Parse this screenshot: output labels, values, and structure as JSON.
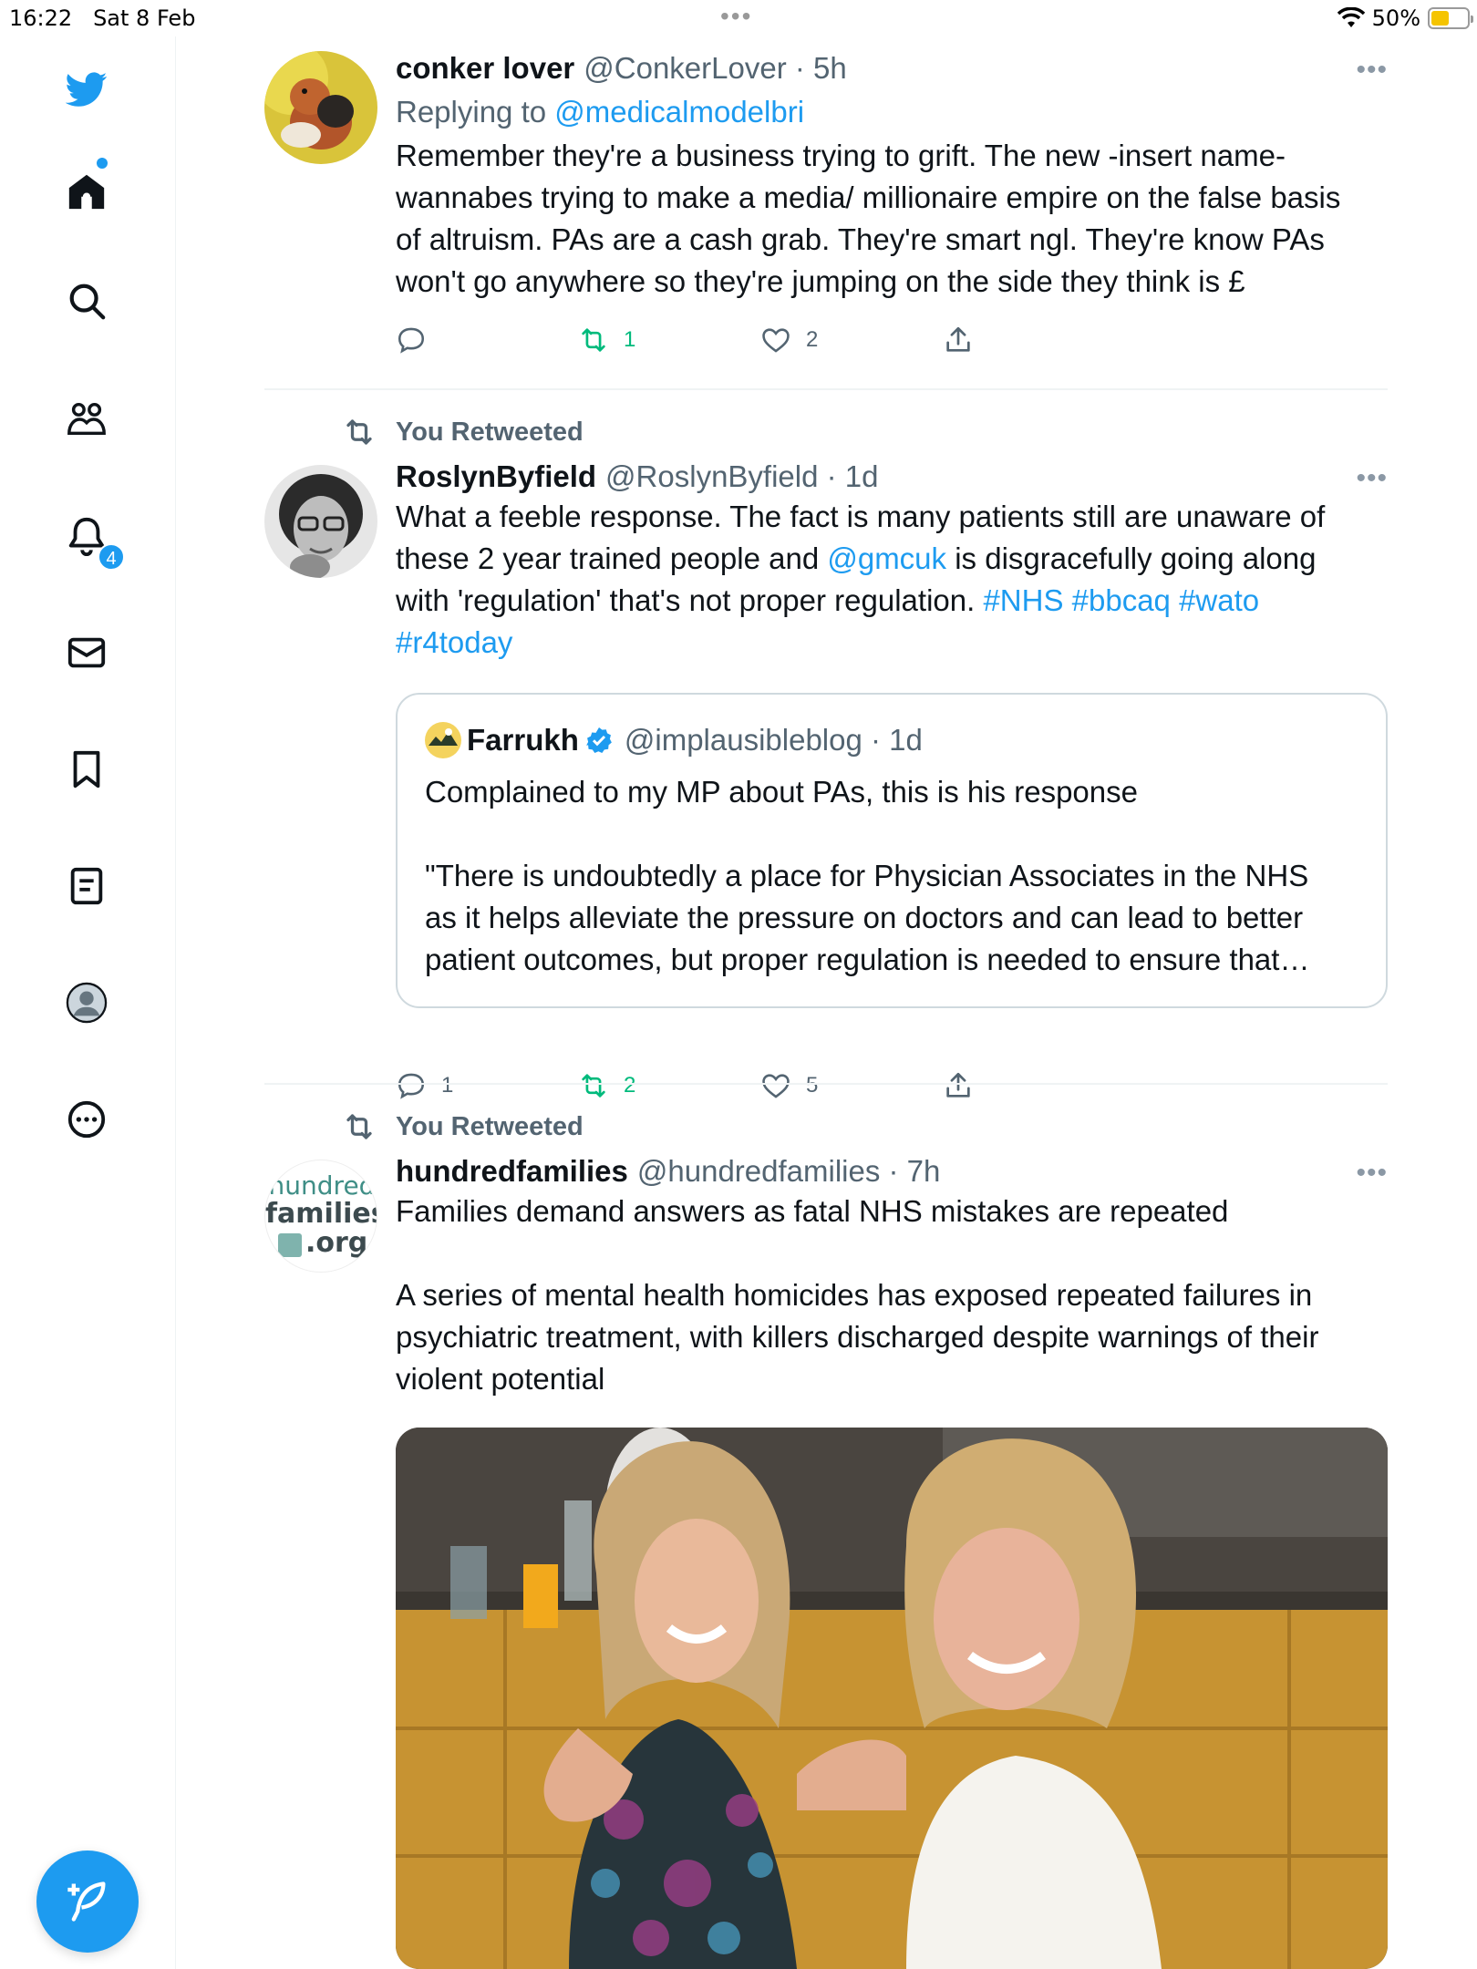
{
  "status_bar": {
    "time": "16:22",
    "date": "Sat 8 Feb",
    "dots": "•••",
    "battery": "50%"
  },
  "sidebar": {
    "notification_count": "4"
  },
  "tweets": [
    {
      "name": "conker lover",
      "handle": "@ConkerLover · 5h",
      "replying_prefix": "Replying to ",
      "replying_handle": "@medicalmodelbri",
      "text": "Remember they're a business trying to grift. The new -insert name-\nwannabes trying to make a media/ millionaire empire on the false basis\nof altruism. PAs are a cash grab. They're smart ngl. They're know PAs\nwon't go anywhere so they're jumping on the side they think is £",
      "reply_count": "",
      "retweet_count": "1",
      "like_count": "2"
    },
    {
      "retweet_label": "You Retweeted",
      "name": "RoslynByfield",
      "handle": "@RoslynByfield · 1d",
      "text_1": "What a feeble response. The fact is many patients still are unaware of\nthese 2 year trained people and ",
      "mention": "@gmcuk",
      "text_2": " is disgracefully going along\nwith 'regulation' that's not proper regulation. ",
      "hashtags_1": "#NHS #bbcaq #wato",
      "hashtags_2": "#r4today",
      "quote": {
        "name": "Farrukh",
        "handle": "@implausibleblog · 1d",
        "text": "Complained to my MP about PAs, this is his response\n\n\"There is undoubtedly a place for Physician Associates in the NHS\nas it helps alleviate the pressure on doctors and can lead to better\npatient outcomes, but proper regulation is needed to ensure that…"
      },
      "reply_count": "1",
      "retweet_count": "2",
      "like_count": "5"
    },
    {
      "retweet_label": "You Retweeted",
      "name": "hundredfamilies",
      "handle": "@hundredfamilies · 7h",
      "avatar_text_1": "hundred",
      "avatar_text_2": "families",
      "avatar_text_3": ".org",
      "text": "Families demand answers as fatal NHS mistakes are repeated\n\nA series of mental health homicides has exposed repeated failures in\npsychiatric treatment, with killers discharged despite warnings of their\nviolent potential"
    }
  ],
  "colors": {
    "accent": "#1d9bf0",
    "retweet_green": "#00ba7c",
    "secondary_text": "#536471"
  },
  "icons": [
    "twitter-logo-icon",
    "home-icon",
    "search-icon",
    "communities-icon",
    "bell-icon",
    "mail-icon",
    "bookmark-icon",
    "lists-icon",
    "profile-icon",
    "more-circle-icon",
    "compose-icon",
    "reply-icon",
    "retweet-icon",
    "like-icon",
    "share-icon",
    "verified-icon",
    "wifi-icon"
  ]
}
